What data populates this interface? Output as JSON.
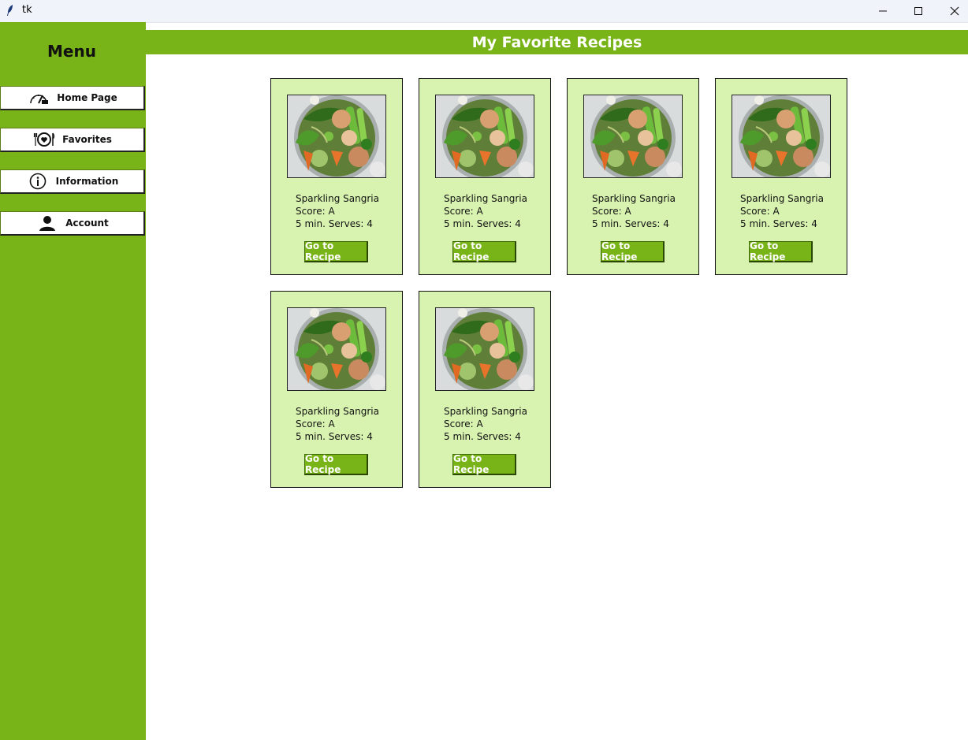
{
  "window": {
    "title": "tk"
  },
  "sidebar": {
    "title": "Menu",
    "items": [
      {
        "label": "Home Page",
        "icon": "speedometer-icon"
      },
      {
        "label": "Favorites",
        "icon": "dinner-plate-heart-icon"
      },
      {
        "label": "Information",
        "icon": "info-icon"
      },
      {
        "label": "Account",
        "icon": "user-icon"
      }
    ]
  },
  "header": {
    "title": "My Favorite Recipes"
  },
  "recipes": [
    {
      "name": "Sparkling Sangria",
      "score": "Score: A",
      "meta": "5 min. Serves: 4",
      "button": "Go to Recipe"
    },
    {
      "name": "Sparkling Sangria",
      "score": "Score: A",
      "meta": "5 min. Serves: 4",
      "button": "Go to Recipe"
    },
    {
      "name": "Sparkling Sangria",
      "score": "Score: A",
      "meta": "5 min. Serves: 4",
      "button": "Go to Recipe"
    },
    {
      "name": "Sparkling Sangria",
      "score": "Score: A",
      "meta": "5 min. Serves: 4",
      "button": "Go to Recipe"
    },
    {
      "name": "Sparkling Sangria",
      "score": "Score: A",
      "meta": "5 min. Serves: 4",
      "button": "Go to Recipe"
    },
    {
      "name": "Sparkling Sangria",
      "score": "Score: A",
      "meta": "5 min. Serves: 4",
      "button": "Go to Recipe"
    }
  ],
  "colors": {
    "accent": "#78b317",
    "card_bg": "#d8f3b0",
    "header_text": "#ffffff"
  }
}
